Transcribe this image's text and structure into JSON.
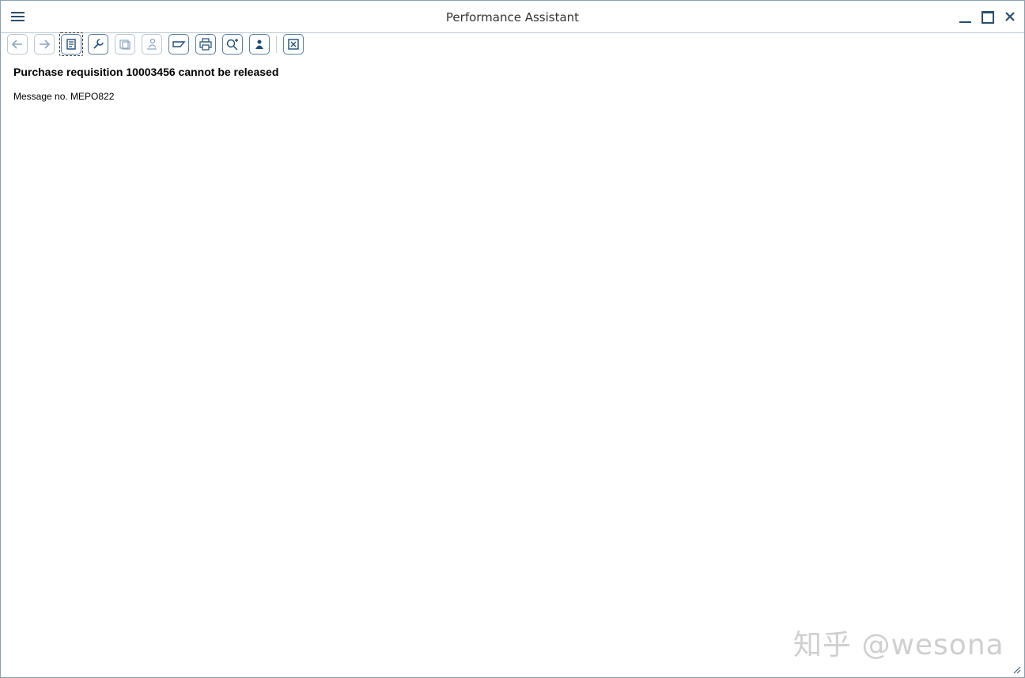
{
  "window": {
    "title": "Performance Assistant"
  },
  "toolbar": {
    "buttons": [
      {
        "icon": "back-arrow-icon",
        "enabled": false
      },
      {
        "icon": "forward-arrow-icon",
        "enabled": false
      },
      {
        "icon": "document-icon",
        "enabled": true,
        "selected": true
      },
      {
        "icon": "wrench-icon",
        "enabled": true
      },
      {
        "icon": "document-stack-icon",
        "enabled": false
      },
      {
        "icon": "person-icon",
        "enabled": false
      },
      {
        "icon": "sap-icon",
        "enabled": true
      },
      {
        "icon": "print-icon",
        "enabled": true
      },
      {
        "icon": "find-icon",
        "enabled": true
      },
      {
        "icon": "user-icon",
        "enabled": true
      },
      {
        "icon": "close-box-icon",
        "enabled": true
      }
    ]
  },
  "content": {
    "heading": "Purchase requisition 10003456 cannot be released",
    "message_number": "Message no. MEPO822"
  },
  "watermark": "知乎 @wesona",
  "colors": {
    "accent": "#2a4e6e",
    "border": "#8aa0b4"
  }
}
